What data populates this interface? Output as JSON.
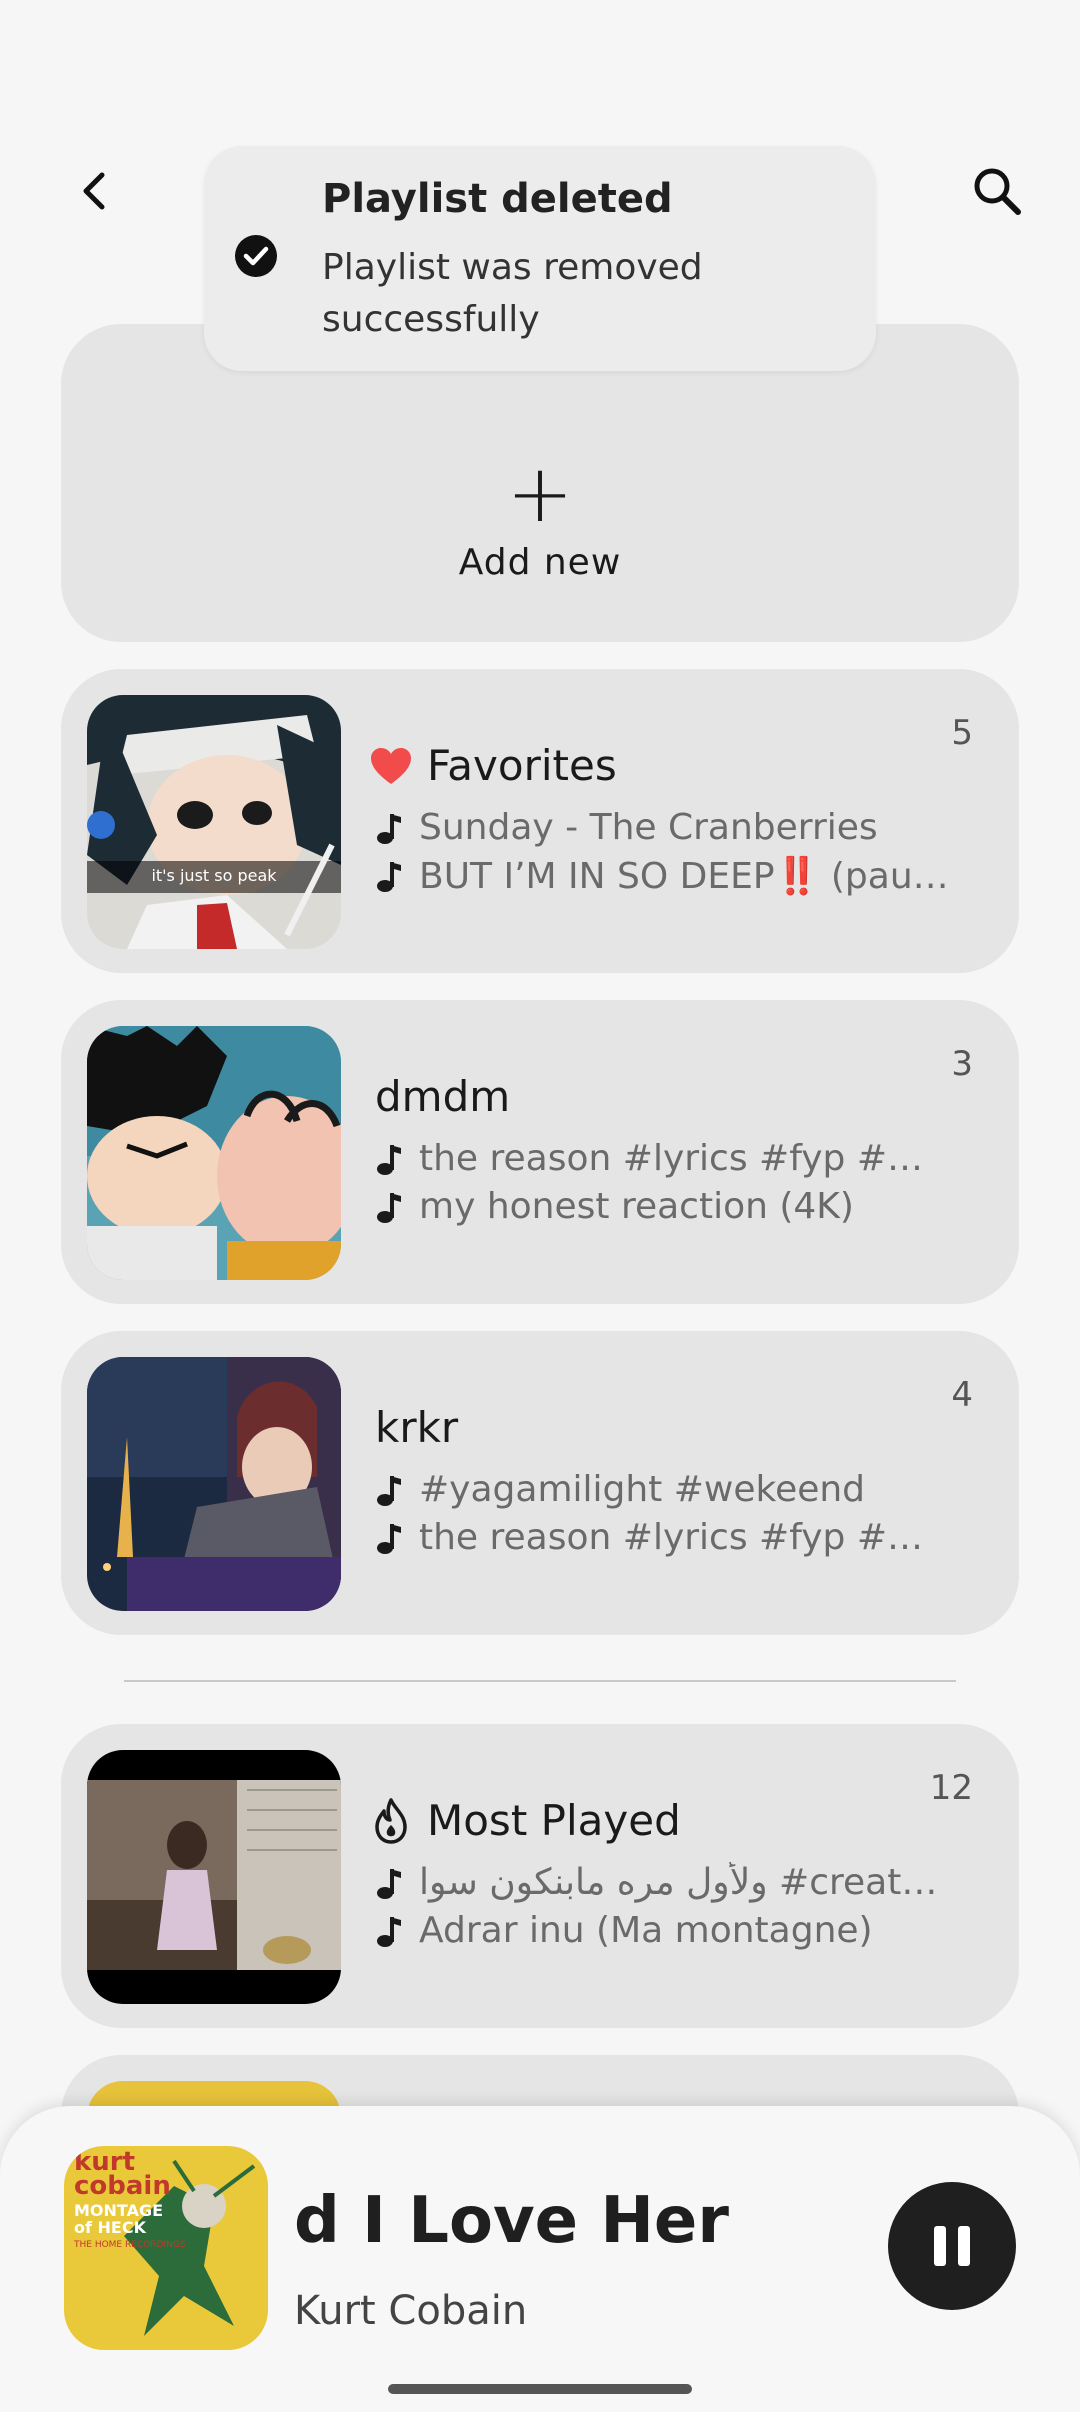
{
  "toast": {
    "title": "Playlist deleted",
    "message": "Playlist was removed successfully"
  },
  "add_new": {
    "label": "Add new"
  },
  "playlists": [
    {
      "title": "Favorites",
      "count": "5",
      "icon": "heart-icon",
      "tracks": [
        "Sunday - The Cranberries",
        "BUT I’M IN SO DEEP‼️ (pau…"
      ],
      "thumb_caption": "it's just so peak"
    },
    {
      "title": "dmdm",
      "count": "3",
      "tracks": [
        "the reason #lyrics #fyp #…",
        "my honest reaction (4K)"
      ]
    },
    {
      "title": "krkr",
      "count": "4",
      "tracks": [
        "#yagamilight #wekeend",
        "the reason #lyrics #fyp #…"
      ]
    }
  ],
  "most_played": {
    "title": "Most Played",
    "count": "12",
    "icon": "flame-icon",
    "tracks": [
      "ولأول مره مابنكون سوا #creat…",
      "Adrar inu (Ma montagne)"
    ]
  },
  "player": {
    "title": "d I Love Her   A",
    "artist": "Kurt Cobain",
    "album_art_text": [
      "kurt",
      "cobain",
      "MONTAGE",
      "of HECK",
      "THE HOME RECORDINGS"
    ],
    "state_icon": "pause-icon"
  },
  "colors": {
    "card": "#e5e5e5",
    "background": "#f6f6f6",
    "heart": "#f24b4b",
    "pause_button": "#1f1f1f"
  }
}
